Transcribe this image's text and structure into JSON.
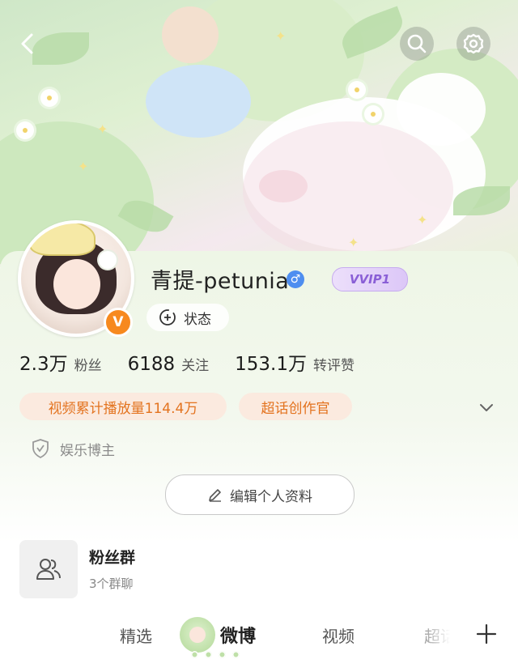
{
  "header": {
    "back_icon": "chevron-left-icon",
    "search_icon": "search-icon",
    "settings_icon": "gear-icon"
  },
  "profile": {
    "username": "青提-petunia",
    "gender_symbol": "♂",
    "vip_badge": "VVIP1",
    "verified_badge": "V",
    "status_label": "状态",
    "stats": [
      {
        "value": "2.3万",
        "label": "粉丝"
      },
      {
        "value": "6188",
        "label": "关注"
      },
      {
        "value": "153.1万",
        "label": "转评赞"
      }
    ],
    "tags": [
      "视频累计播放量114.4万",
      "超话创作官"
    ],
    "certification": "娱乐博主",
    "edit_button": "编辑个人资料"
  },
  "fan_group": {
    "title": "粉丝群",
    "subtitle": "3个群聊"
  },
  "tabs": [
    {
      "label": "精选",
      "active": false
    },
    {
      "label": "微博",
      "active": true
    },
    {
      "label": "视频",
      "active": false
    },
    {
      "label": "超话",
      "active": false
    }
  ],
  "colors": {
    "accent_orange": "#e3731f",
    "verified_orange": "#f7891e",
    "gender_blue": "#4e8ef0",
    "vip_purple": "#8a5fd6"
  }
}
